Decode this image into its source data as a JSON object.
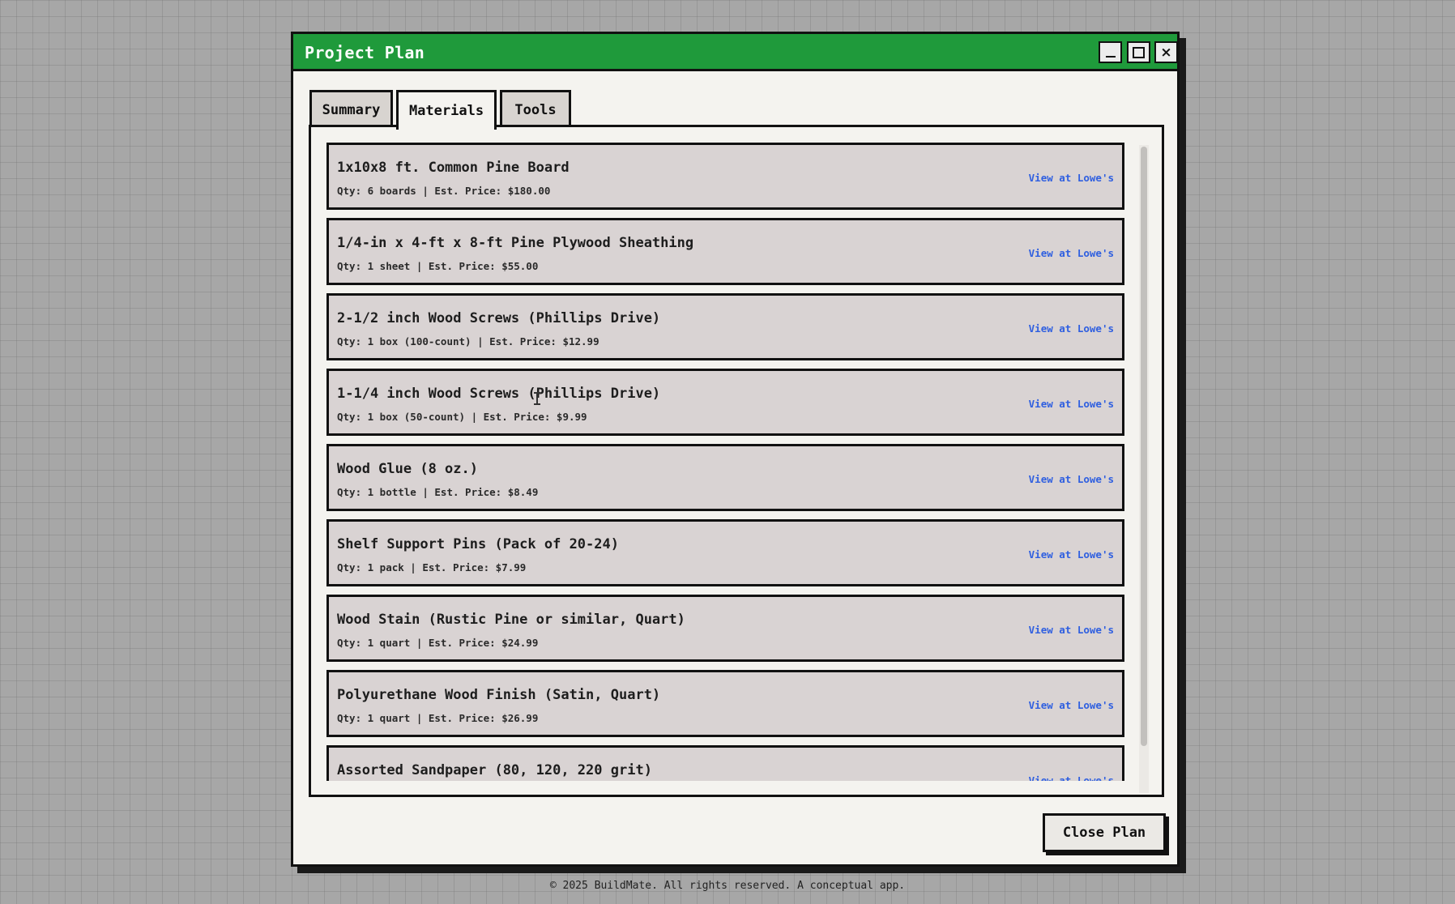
{
  "window": {
    "title": "Project Plan",
    "controls": {
      "minimize": "minimize-icon",
      "maximize": "maximize-icon",
      "close": "×"
    }
  },
  "tabs": [
    {
      "label": "Summary",
      "active": false
    },
    {
      "label": "Materials",
      "active": true
    },
    {
      "label": "Tools",
      "active": false
    }
  ],
  "materials": [
    {
      "name": "1x10x8 ft. Common Pine Board",
      "detail": "Qty: 6 boards | Est. Price: $180.00",
      "link": "View at Lowe's"
    },
    {
      "name": "1/4-in x 4-ft x 8-ft Pine Plywood Sheathing",
      "detail": "Qty: 1 sheet | Est. Price: $55.00",
      "link": "View at Lowe's"
    },
    {
      "name": "2-1/2 inch Wood Screws (Phillips Drive)",
      "detail": "Qty: 1 box (100-count) | Est. Price: $12.99",
      "link": "View at Lowe's"
    },
    {
      "name": "1-1/4 inch Wood Screws (Phillips Drive)",
      "detail": "Qty: 1 box (50-count) | Est. Price: $9.99",
      "link": "View at Lowe's"
    },
    {
      "name": "Wood Glue (8 oz.)",
      "detail": "Qty: 1 bottle | Est. Price: $8.49",
      "link": "View at Lowe's"
    },
    {
      "name": "Shelf Support Pins (Pack of 20-24)",
      "detail": "Qty: 1 pack | Est. Price: $7.99",
      "link": "View at Lowe's"
    },
    {
      "name": "Wood Stain (Rustic Pine or similar, Quart)",
      "detail": "Qty: 1 quart | Est. Price: $24.99",
      "link": "View at Lowe's"
    },
    {
      "name": "Polyurethane Wood Finish (Satin, Quart)",
      "detail": "Qty: 1 quart | Est. Price: $26.99",
      "link": "View at Lowe's"
    },
    {
      "name": "Assorted Sandpaper (80, 120, 220 grit)",
      "detail": "",
      "link": "View at Lowe's"
    }
  ],
  "actions": {
    "close_plan": "Close Plan"
  },
  "footer": {
    "text": "© 2025 BuildMate. All rights reserved. A conceptual app."
  },
  "colors": {
    "titlebar": "#1f9a3b",
    "link": "#2f5fe0",
    "item_bg": "#d9d3d3",
    "window_bg": "#f4f3ef"
  }
}
